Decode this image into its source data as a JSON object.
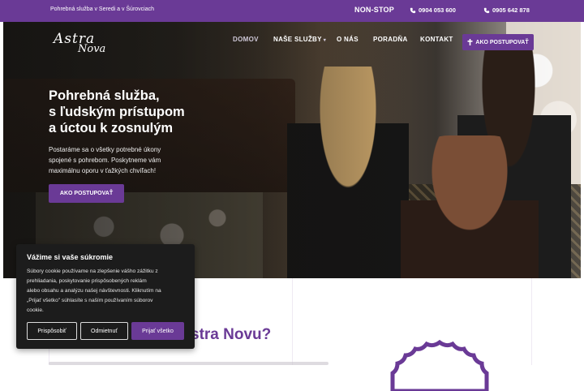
{
  "topbar": {
    "tagline": "Pohrebná služba v Seredi a v Šúrovciach",
    "nonstop": "NON-STOP",
    "phone1": "0904 053 600",
    "phone2": "0905 642 878"
  },
  "logo": {
    "line1": "Astra",
    "line2": "Nova"
  },
  "nav": {
    "items": [
      "DOMOV",
      "NAŠE SLUŽBY",
      "O NÁS",
      "PORADŇA",
      "KONTAKT"
    ],
    "cta": "AKO POSTUPOVAŤ"
  },
  "hero": {
    "title_line1": "Pohrebná služba,",
    "title_line2": "s ľudským prístupom",
    "title_line3": "a úctou k zosnulým",
    "text_line1": "Postaráme sa o všetky potrebné úkony",
    "text_line2": "spojené s pohrebom. Poskytneme vám",
    "text_line3": "maximálnu oporu v ťažkých chvíľach!",
    "cta": "AKO POSTUPOVAŤ"
  },
  "section": {
    "title_visible": "stra Novu?"
  },
  "cookie": {
    "title": "Vážime si vaše súkromie",
    "line1": "Súbory cookie používame na zlepšenie vášho zážitku z",
    "line2": "prehliadania, poskytovanie prispôsobených reklám",
    "line3": "alebo obsahu a analýzu našej návštevnosti. Kliknutím na",
    "line4": "„Prijať všetko\" súhlasíte s naším používaním súborov",
    "line5": "cookie.",
    "btn_customize": "Prispôsobiť",
    "btn_reject": "Odmietnuť",
    "btn_accept": "Prijať všetko"
  },
  "colors": {
    "brand": "#6a3a96",
    "cookie_bg": "#1c1c1c"
  }
}
